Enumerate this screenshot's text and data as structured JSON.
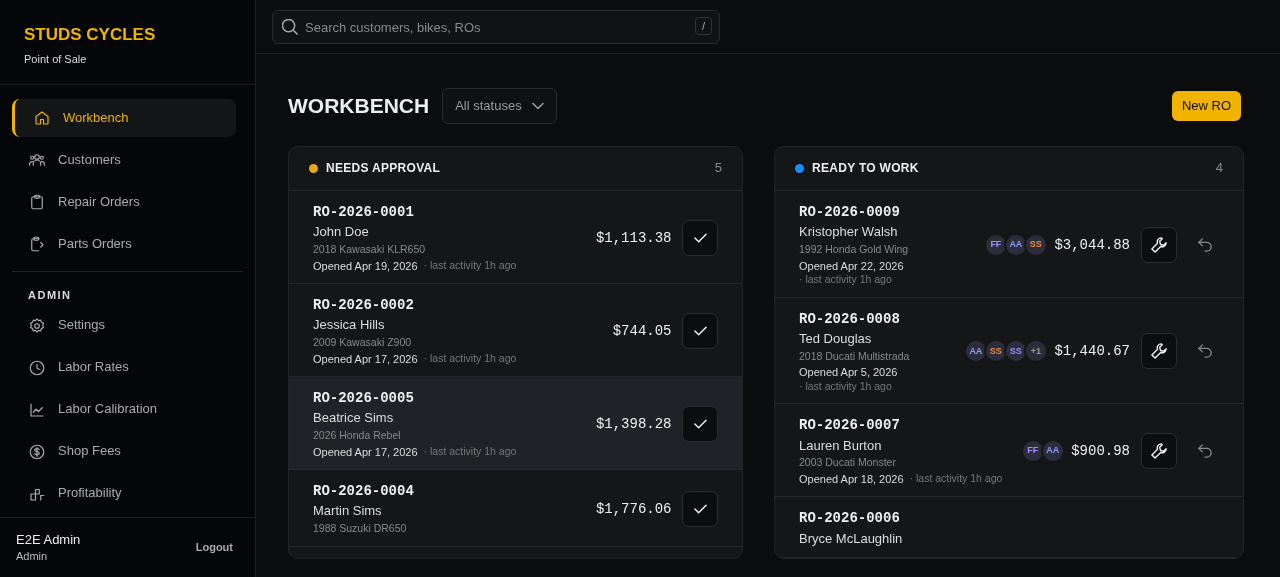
{
  "brand": {
    "name": "STUDS CYCLES",
    "subtitle": "Point of Sale"
  },
  "sidebar": {
    "items": [
      {
        "label": "Workbench",
        "selected": true
      },
      {
        "label": "Customers",
        "selected": false
      },
      {
        "label": "Repair Orders",
        "selected": false
      },
      {
        "label": "Parts Orders",
        "selected": false
      }
    ],
    "admin_heading": "ADMIN",
    "admin_items": [
      {
        "label": "Settings",
        "selected": false
      },
      {
        "label": "Labor Rates",
        "selected": false
      },
      {
        "label": "Labor Calibration",
        "selected": false
      },
      {
        "label": "Shop Fees",
        "selected": false
      },
      {
        "label": "Profitability",
        "selected": false
      }
    ],
    "user": {
      "name": "E2E Admin",
      "role": "Admin",
      "logout": "Logout"
    }
  },
  "search": {
    "placeholder": "Search customers, bikes, ROs",
    "shortcut": "/"
  },
  "page": {
    "title": "WORKBENCH",
    "filter": "All statuses",
    "new_button": "New RO"
  },
  "columns": [
    {
      "title": "NEEDS APPROVAL",
      "color": "#e6a817",
      "count": "5",
      "cards": [
        {
          "ro": "RO-2026-0001",
          "customer": "John Doe",
          "bike": "2018 Kawasaki KLR650",
          "opened": "Opened Apr 19, 2026",
          "activity": "· last activity 1h ago",
          "total": "$1,113.38",
          "selected": false
        },
        {
          "ro": "RO-2026-0002",
          "customer": "Jessica Hills",
          "bike": "2009 Kawasaki Z900",
          "opened": "Opened Apr 17, 2026",
          "activity": "· last activity 1h ago",
          "total": "$744.05",
          "selected": false
        },
        {
          "ro": "RO-2026-0005",
          "customer": "Beatrice Sims",
          "bike": "2026 Honda Rebel",
          "opened": "Opened Apr 17, 2026",
          "activity": "· last activity 1h ago",
          "total": "$1,398.28",
          "selected": true
        },
        {
          "ro": "RO-2026-0004",
          "customer": "Martin Sims",
          "bike": "1988 Suzuki DR650",
          "total": "$1,776.06",
          "selected": false
        }
      ]
    },
    {
      "title": "READY TO WORK",
      "color": "#1a8cff",
      "count": "4",
      "cards": [
        {
          "ro": "RO-2026-0009",
          "customer": "Kristopher Walsh",
          "bike": "1992 Honda Gold Wing",
          "opened": "Opened Apr 22, 2026",
          "activity": "· last activity 1h ago",
          "total": "$3,044.88",
          "selected": false,
          "avatars": [
            {
              "text": "FF",
              "color": "#a78bfa"
            },
            {
              "text": "AA",
              "color": "#8b9cf8"
            },
            {
              "text": "SS",
              "color": "#f0883e"
            }
          ]
        },
        {
          "ro": "RO-2026-0008",
          "customer": "Ted Douglas",
          "bike": "2018 Ducati Multistrada",
          "opened": "Opened Apr 5, 2026",
          "activity": "· last activity 1h ago",
          "total": "$1,440.67",
          "selected": false,
          "avatars": [
            {
              "text": "AA",
              "color": "#8b9cf8"
            },
            {
              "text": "SS",
              "color": "#f0883e"
            },
            {
              "text": "SS",
              "color": "#a78bfa"
            },
            {
              "text": "+1",
              "color": "#9a9a9a"
            }
          ]
        },
        {
          "ro": "RO-2026-0007",
          "customer": "Lauren Burton",
          "bike": "2003 Ducati Monster",
          "opened": "Opened Apr 18, 2026",
          "activity": "· last activity 1h ago",
          "total": "$900.98",
          "selected": false,
          "avatars": [
            {
              "text": "FF",
              "color": "#a78bfa"
            },
            {
              "text": "AA",
              "color": "#8b9cf8"
            }
          ]
        },
        {
          "ro": "RO-2026-0006",
          "customer": "Bryce McLaughlin",
          "selected": false
        }
      ]
    }
  ]
}
